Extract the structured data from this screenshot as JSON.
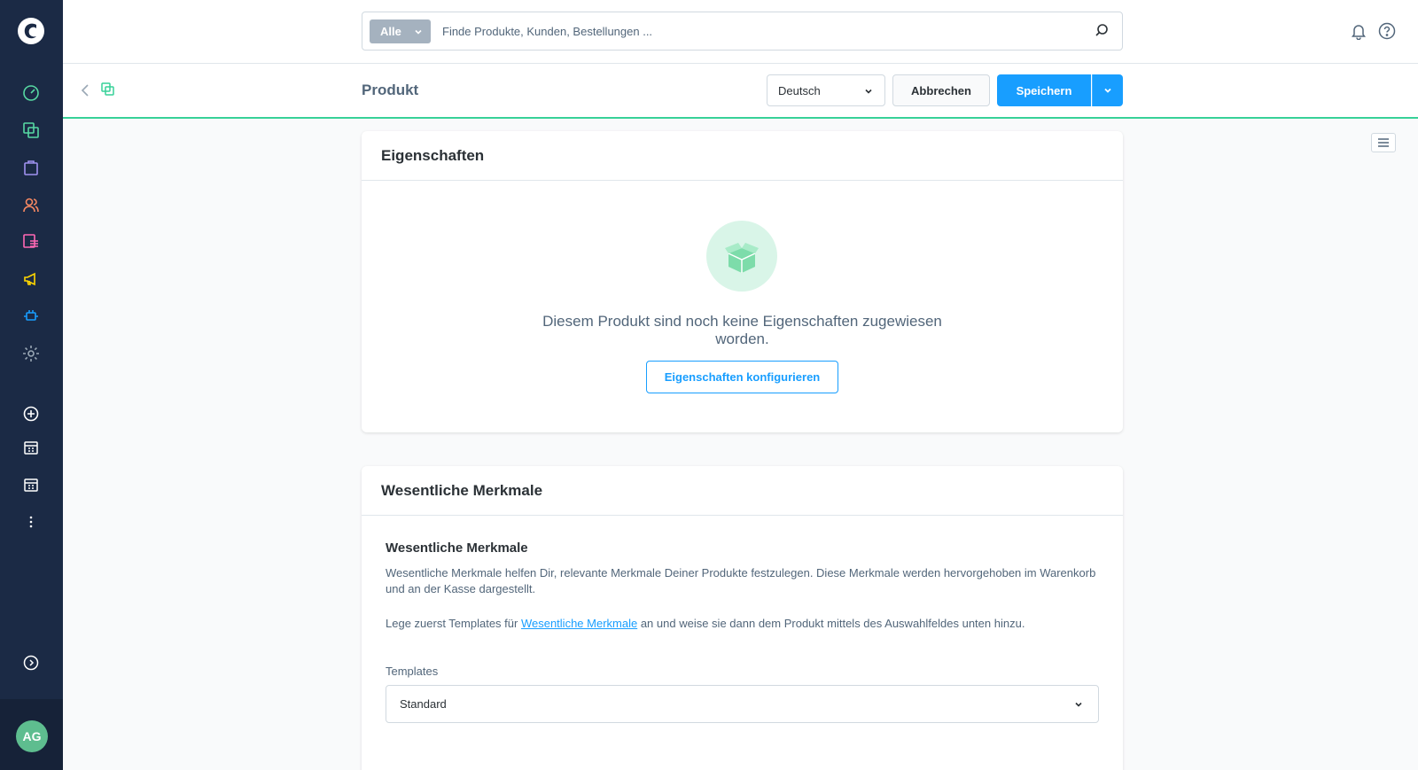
{
  "sidebar": {
    "avatar_initials": "AG",
    "items": [
      {
        "icon": "dashboard-icon",
        "color": "#57d9a3"
      },
      {
        "icon": "catalogue-icon",
        "color": "#57d9a3"
      },
      {
        "icon": "orders-icon",
        "color": "#a092f0"
      },
      {
        "icon": "customers-icon",
        "color": "#f88962"
      },
      {
        "icon": "content-icon",
        "color": "#ff68b4"
      },
      {
        "icon": "marketing-icon",
        "color": "#ffd700"
      },
      {
        "icon": "extensions-icon",
        "color": "#189eff"
      },
      {
        "icon": "settings-icon",
        "color": "#9aa8b5"
      }
    ]
  },
  "search": {
    "type_label": "Alle",
    "placeholder": "Finde Produkte, Kunden, Bestellungen ..."
  },
  "smartbar": {
    "title": "Produkt",
    "language": "Deutsch",
    "cancel_label": "Abbrechen",
    "save_label": "Speichern"
  },
  "properties_card": {
    "title": "Eigenschaften",
    "empty_text": "Diesem Produkt sind noch keine Eigenschaften zugewiesen worden.",
    "configure_label": "Eigenschaften konfigurieren"
  },
  "features_card": {
    "title": "Wesentliche Merkmale",
    "subtitle": "Wesentliche Merkmale",
    "description": "Wesentliche Merkmale helfen Dir, relevante Merkmale Deiner Produkte festzulegen. Diese Merkmale werden hervorgehoben im Warenkorb und an der Kasse dargestellt.",
    "hint_before": "Lege zuerst Templates für ",
    "hint_link": "Wesentliche Merkmale",
    "hint_after": " an und weise sie dann dem Produkt mittels des Auswahlfeldes unten hinzu.",
    "templates_label": "Templates",
    "templates_value": "Standard"
  },
  "colors": {
    "primary": "#189eff",
    "sidebar_bg": "#1b2a45",
    "accent_green": "#37d198"
  }
}
